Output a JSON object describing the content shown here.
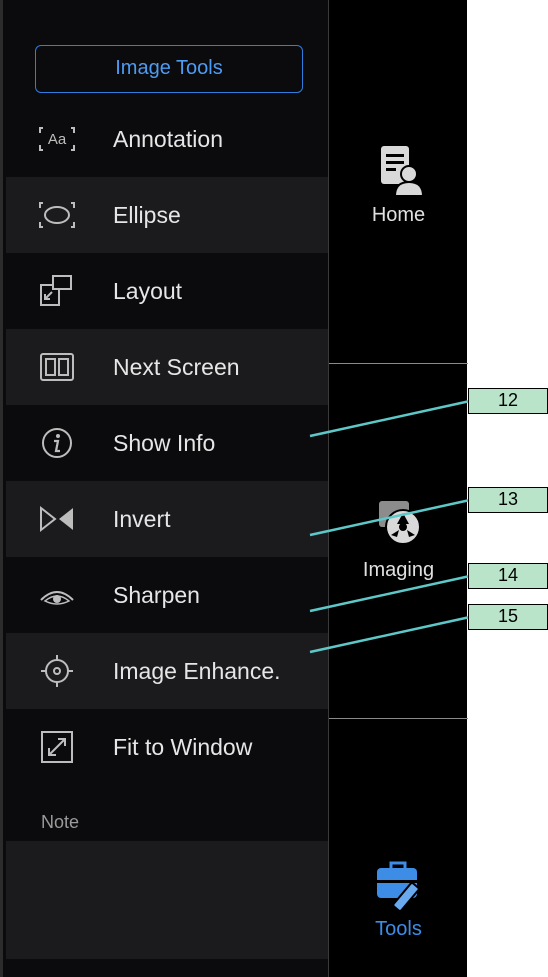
{
  "left_panel": {
    "header": "Image Tools",
    "items": [
      {
        "label": "Annotation",
        "icon": "annotation-icon"
      },
      {
        "label": "Ellipse",
        "icon": "ellipse-icon"
      },
      {
        "label": "Layout",
        "icon": "layout-icon"
      },
      {
        "label": "Next Screen",
        "icon": "next-screen-icon"
      },
      {
        "label": "Show Info",
        "icon": "info-icon"
      },
      {
        "label": "Invert",
        "icon": "invert-icon"
      },
      {
        "label": "Sharpen",
        "icon": "eye-icon"
      },
      {
        "label": "Image Enhance.",
        "icon": "target-icon"
      },
      {
        "label": "Fit to Window",
        "icon": "fit-window-icon"
      }
    ],
    "note_label": "Note",
    "annotation_icon_text": "Aa"
  },
  "right_panel": {
    "items": [
      {
        "label": "Home",
        "icon": "home-document-user-icon"
      },
      {
        "label": "Imaging",
        "icon": "imaging-icon"
      },
      {
        "label": "Tools",
        "icon": "toolbox-icon",
        "active": true
      }
    ]
  },
  "callouts": [
    "12",
    "13",
    "14",
    "15"
  ],
  "colors": {
    "accent": "#3d8de6",
    "callout_fill": "#b9e4c9",
    "callout_line": "#5ec8c8",
    "panel_bg": "#0b0b0d",
    "row_shade": "#1b1b1e"
  }
}
